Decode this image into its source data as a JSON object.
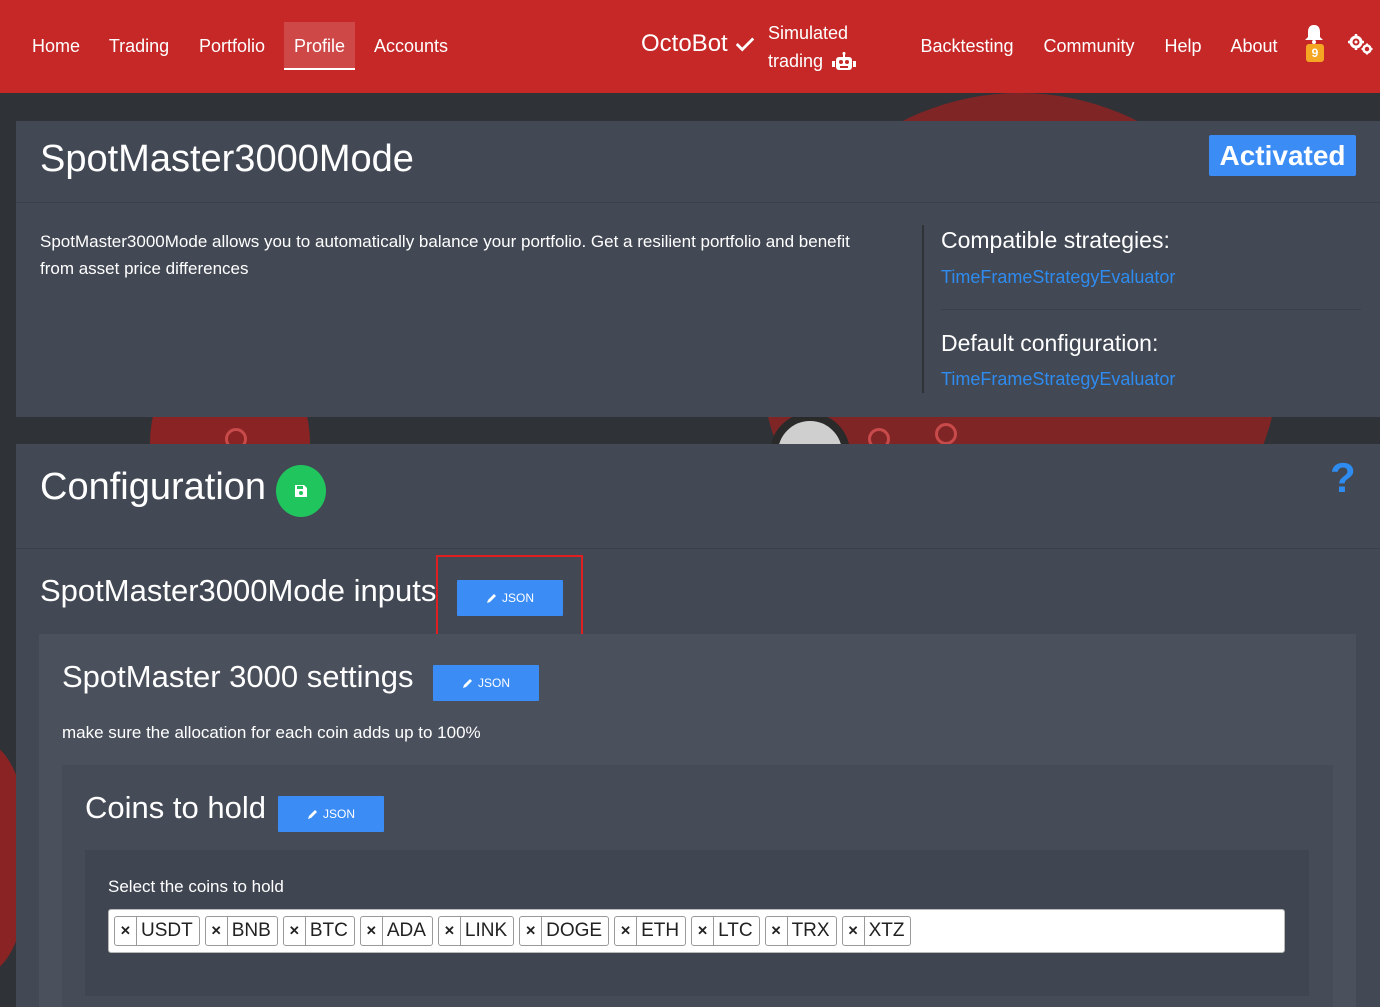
{
  "nav": {
    "left_items": [
      {
        "label": "Home",
        "active": false
      },
      {
        "label": "Trading",
        "active": false
      },
      {
        "label": "Portfolio",
        "active": false
      },
      {
        "label": "Profile",
        "active": true
      },
      {
        "label": "Accounts",
        "active": false
      }
    ],
    "brand": "OctoBot",
    "mode_line1": "Simulated",
    "mode_line2": "trading",
    "right_items": [
      "Backtesting",
      "Community",
      "Help",
      "About"
    ],
    "notification_count": "9",
    "icons": [
      "check-icon",
      "robot-icon",
      "bell-icon",
      "gears-icon"
    ]
  },
  "profile": {
    "title": "SpotMaster3000Mode",
    "status": "Activated",
    "description": "SpotMaster3000Mode allows you to automatically balance your portfolio. Get a resilient portfolio and benefit from asset price differences",
    "compatible_heading": "Compatible strategies:",
    "compatible_link": "TimeFrameStrategyEvaluator",
    "default_heading": "Default configuration:",
    "default_link": "TimeFrameStrategyEvaluator"
  },
  "configuration": {
    "title": "Configuration",
    "help_symbol": "?",
    "inputs_title": "SpotMaster3000Mode inputs",
    "json_label": "JSON",
    "settings_title": "SpotMaster 3000 settings",
    "settings_note": "make sure the allocation for each coin adds up to 100%",
    "coins_title": "Coins to hold",
    "coins_label": "Select the coins to hold",
    "coins": [
      "USDT",
      "BNB",
      "BTC",
      "ADA",
      "LINK",
      "DOGE",
      "ETH",
      "LTC",
      "TRX",
      "XTZ"
    ]
  },
  "colors": {
    "navbar": "#c62828",
    "card": "#424854",
    "accent_blue": "#3b8cf5",
    "save_green": "#21c55d",
    "link_blue": "#2e8cf0"
  }
}
